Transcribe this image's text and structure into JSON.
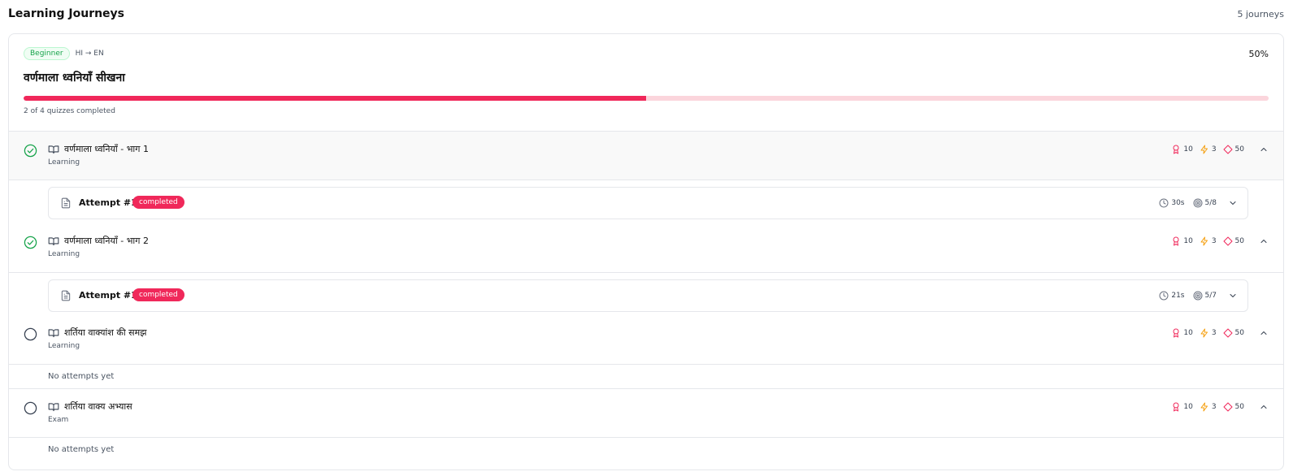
{
  "header": {
    "title": "Learning Journeys",
    "count": "5 journeys"
  },
  "journey": {
    "level": "Beginner",
    "lang_pair": "HI → EN",
    "percent_label": "50%",
    "progress": 0.5,
    "title": "वर्णमाला ध्वनियाँ सीखना",
    "caption": "2 of 4 quizzes completed"
  },
  "quizzes": [
    {
      "name": "वर्णमाला ध्वनियाँ - भाग 1",
      "type": "Learning",
      "status": "completed",
      "stats": {
        "reward": "10",
        "energy": "3",
        "gems": "50"
      },
      "attempt": {
        "label": "Attempt #1",
        "status": "completed",
        "time": "30s",
        "score": "5/8"
      }
    },
    {
      "name": "वर्णमाला ध्वनियाँ - भाग 2",
      "type": "Learning",
      "status": "completed",
      "stats": {
        "reward": "10",
        "energy": "3",
        "gems": "50"
      },
      "attempt": {
        "label": "Attempt #1",
        "status": "completed",
        "time": "21s",
        "score": "5/7"
      }
    },
    {
      "name": "शर्तिया वाक्यांश की समझ",
      "type": "Learning",
      "status": "pending",
      "stats": {
        "reward": "10",
        "energy": "3",
        "gems": "50"
      },
      "no_attempts": "No attempts yet"
    },
    {
      "name": "शर्तिया वाक्य अभ्यास",
      "type": "Exam",
      "status": "pending",
      "stats": {
        "reward": "10",
        "energy": "3",
        "gems": "50"
      },
      "no_attempts": "No attempts yet"
    }
  ],
  "colors": {
    "accent": "#f0285a",
    "success": "#16a34a",
    "energy": "#f59e0b"
  },
  "icons": [
    "check-circle-icon",
    "circle-icon",
    "book-icon",
    "award-icon",
    "zap-icon",
    "gem-icon",
    "chevron-up-icon",
    "chevron-down-icon",
    "file-icon",
    "clock-icon",
    "target-icon"
  ]
}
